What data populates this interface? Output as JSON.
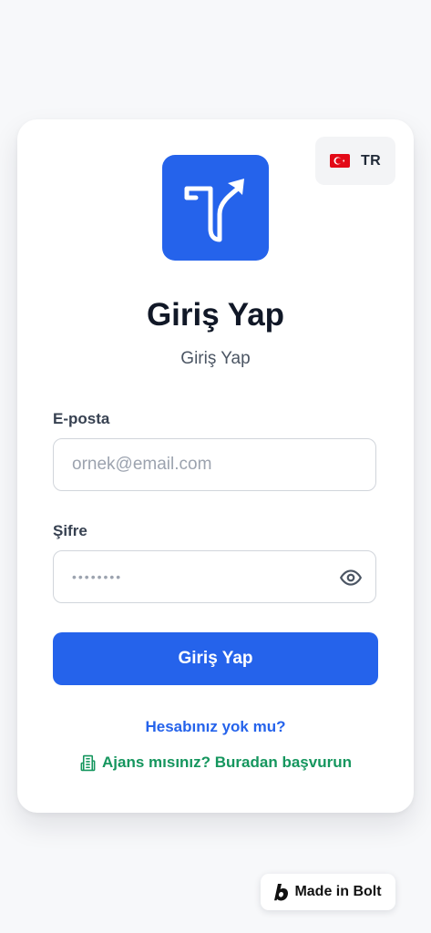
{
  "language": {
    "code": "TR",
    "flag_icon": "turkey-flag-icon"
  },
  "brand": {
    "logo_icon": "route-arrow-logo-icon",
    "accent_color": "#2563eb"
  },
  "header": {
    "title": "Giriş Yap",
    "subtitle": "Giriş Yap"
  },
  "form": {
    "email": {
      "label": "E-posta",
      "placeholder": "ornek@email.com",
      "value": ""
    },
    "password": {
      "label": "Şifre",
      "masked_value": "••••••••",
      "toggle_icon": "eye-icon"
    },
    "submit_label": "Giriş Yap"
  },
  "links": {
    "register": "Hesabınız yok mu?",
    "agency": "Ajans mısınız? Buradan başvurun",
    "agency_icon": "building-icon",
    "agency_color": "#15965e"
  },
  "badge": {
    "label": "Made in Bolt",
    "icon": "bolt-logo-icon"
  }
}
